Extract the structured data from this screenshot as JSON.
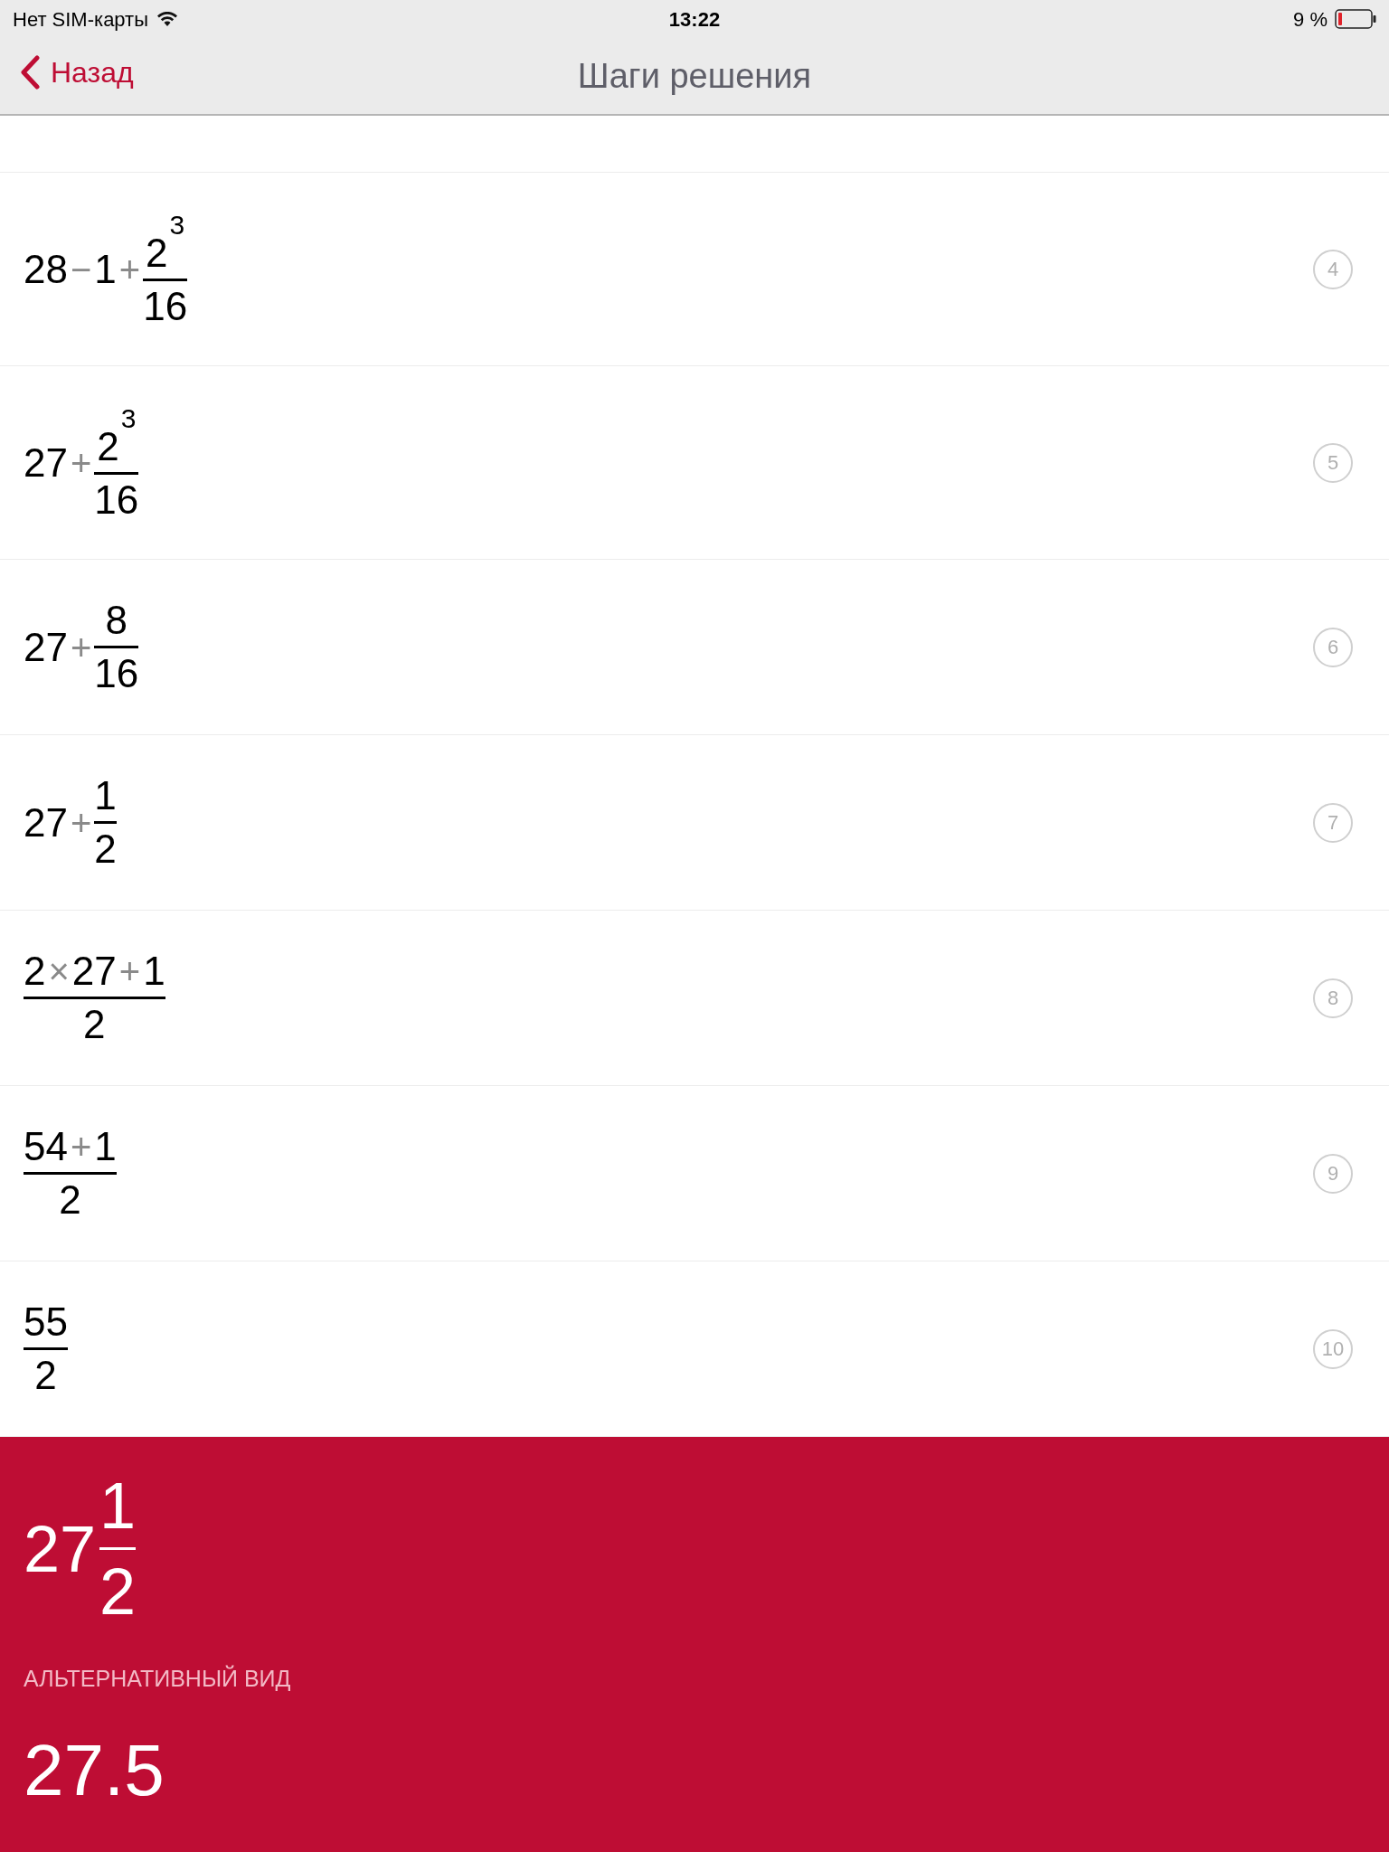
{
  "status_bar": {
    "carrier": "Нет SIM-карты",
    "time": "13:22",
    "battery": "9 %"
  },
  "nav": {
    "back": "Назад",
    "title": "Шаги решения"
  },
  "steps": [
    {
      "number": "4",
      "expression": [
        {
          "kind": "num",
          "text": "28"
        },
        {
          "kind": "op",
          "text": "−"
        },
        {
          "kind": "num",
          "text": "1"
        },
        {
          "kind": "op",
          "text": "+"
        },
        {
          "kind": "frac",
          "num": [
            {
              "kind": "pow",
              "base": "2",
              "exp": "3"
            }
          ],
          "den": [
            {
              "kind": "num",
              "text": "16"
            }
          ]
        }
      ]
    },
    {
      "number": "5",
      "expression": [
        {
          "kind": "num",
          "text": "27"
        },
        {
          "kind": "op",
          "text": "+"
        },
        {
          "kind": "frac",
          "num": [
            {
              "kind": "pow",
              "base": "2",
              "exp": "3"
            }
          ],
          "den": [
            {
              "kind": "num",
              "text": "16"
            }
          ]
        }
      ]
    },
    {
      "number": "6",
      "expression": [
        {
          "kind": "num",
          "text": "27"
        },
        {
          "kind": "op",
          "text": "+"
        },
        {
          "kind": "frac",
          "num": [
            {
              "kind": "num",
              "text": "8"
            }
          ],
          "den": [
            {
              "kind": "num",
              "text": "16"
            }
          ]
        }
      ]
    },
    {
      "number": "7",
      "expression": [
        {
          "kind": "num",
          "text": "27"
        },
        {
          "kind": "op",
          "text": "+"
        },
        {
          "kind": "frac",
          "num": [
            {
              "kind": "num",
              "text": "1"
            }
          ],
          "den": [
            {
              "kind": "num",
              "text": "2"
            }
          ]
        }
      ]
    },
    {
      "number": "8",
      "expression": [
        {
          "kind": "frac",
          "num": [
            {
              "kind": "num",
              "text": "2"
            },
            {
              "kind": "op",
              "text": "×"
            },
            {
              "kind": "num",
              "text": "27"
            },
            {
              "kind": "op",
              "text": "+"
            },
            {
              "kind": "num",
              "text": "1"
            }
          ],
          "den": [
            {
              "kind": "num",
              "text": "2"
            }
          ]
        }
      ]
    },
    {
      "number": "9",
      "expression": [
        {
          "kind": "frac",
          "num": [
            {
              "kind": "num",
              "text": "54"
            },
            {
              "kind": "op",
              "text": "+"
            },
            {
              "kind": "num",
              "text": "1"
            }
          ],
          "den": [
            {
              "kind": "num",
              "text": "2"
            }
          ]
        }
      ]
    },
    {
      "number": "10",
      "expression": [
        {
          "kind": "frac",
          "num": [
            {
              "kind": "num",
              "text": "55"
            }
          ],
          "den": [
            {
              "kind": "num",
              "text": "2"
            }
          ]
        }
      ]
    }
  ],
  "result": {
    "expression": [
      {
        "kind": "num",
        "text": "27"
      },
      {
        "kind": "frac",
        "num": [
          {
            "kind": "num",
            "text": "1"
          }
        ],
        "den": [
          {
            "kind": "num",
            "text": "2"
          }
        ]
      }
    ],
    "alt_label": "АЛЬТЕРНАТИВНЫЙ ВИД",
    "alt_value": "27.5"
  }
}
